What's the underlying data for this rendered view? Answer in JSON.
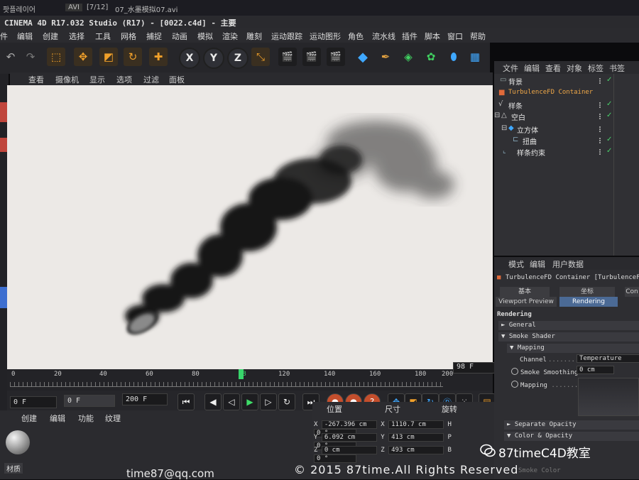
{
  "os_bar": {
    "left_label": "팟플레이어",
    "format": "AVI",
    "playlist_pos": "[7/12]",
    "file_name": "07_水墨模拟07.avi"
  },
  "title_bar": {
    "text": "CINEMA 4D R17.032 Studio (R17) - [0022.c4d] - 主要"
  },
  "menu": [
    "件",
    "编辑",
    "创建",
    "选择",
    "工具",
    "网格",
    "捕捉",
    "动画",
    "模拟",
    "渲染",
    "雕刻",
    "运动跟踪",
    "运动图形",
    "角色",
    "流水线",
    "插件",
    "脚本",
    "窗口",
    "帮助"
  ],
  "toolbar": {
    "axis_x": "X",
    "axis_y": "Y",
    "axis_z": "Z",
    "icons": [
      "undo-icon",
      "select-icon",
      "move-icon",
      "scale-icon",
      "rotate-icon",
      "add-icon",
      "coordinate-icon",
      "render-view-icon",
      "render-icon",
      "render-settings-icon",
      "cube-icon",
      "pen-icon",
      "subdivision-icon",
      "cloner-icon",
      "deformer-icon",
      "floor-icon"
    ]
  },
  "viewport": {
    "menu": [
      "查看",
      "摄像机",
      "显示",
      "选项",
      "过滤",
      "面板"
    ],
    "colors": {
      "background": "#ece9e6",
      "smoke": "#141414"
    }
  },
  "timeline": {
    "ticks": [
      "0",
      "20",
      "40",
      "60",
      "80",
      "100",
      "120",
      "140",
      "160",
      "180",
      "200"
    ],
    "current_frame": 98,
    "current_label": "98",
    "frame_display": "98 F"
  },
  "playback": {
    "start": "0 F",
    "min": "0 F",
    "max": "200 F",
    "buttons": [
      "go-start-icon",
      "prev-key-icon",
      "play-back-icon",
      "play-icon",
      "next-key-icon",
      "record-icon",
      "go-end-icon"
    ]
  },
  "material_panel": {
    "menu": [
      "创建",
      "编辑",
      "功能",
      "纹理"
    ],
    "material_label": "材质"
  },
  "coords_panel": {
    "headers": [
      "位置",
      "尺寸",
      "旋转"
    ],
    "rows": [
      {
        "axis": "X",
        "pos": "-267.396 cm",
        "size_axis": "X",
        "size": "1110.7 cm",
        "rot_axis": "H",
        "rot": "0 °"
      },
      {
        "axis": "Y",
        "pos": "6.092 cm",
        "size_axis": "Y",
        "size": "413 cm",
        "rot_axis": "P",
        "rot": "0 °"
      },
      {
        "axis": "Z",
        "pos": "0 cm",
        "size_axis": "Z",
        "size": "493 cm",
        "rot_axis": "B",
        "rot": "0 °"
      }
    ]
  },
  "object_manager": {
    "menu": [
      "文件",
      "编辑",
      "查看",
      "对象",
      "标签",
      "书签"
    ],
    "objects": [
      {
        "name": "背景",
        "icon": "background-icon"
      },
      {
        "name": "TurbulenceFD Container",
        "icon": "turbulence-icon"
      },
      {
        "name": "样条",
        "icon": "spline-icon"
      },
      {
        "name": "空白",
        "icon": "null-icon"
      },
      {
        "name": "立方体",
        "icon": "cube-icon"
      },
      {
        "name": "扭曲",
        "icon": "twist-icon"
      },
      {
        "name": "样条约束",
        "icon": "spline-wrap-icon"
      }
    ]
  },
  "attribute_manager": {
    "menu": [
      "模式",
      "编辑",
      "用户数据"
    ],
    "object_title": "TurbulenceFD Container [TurbulenceFD C",
    "tabs_row1": [
      "基本",
      "坐标",
      "Con"
    ],
    "tabs_row2": [
      "Viewport Preview",
      "Rendering"
    ],
    "section": "Rendering",
    "groups": [
      "General",
      "Smoke Shader",
      "Mapping"
    ],
    "channel_label": "Channel",
    "channel_value": "Temperature",
    "smoothing_label": "Smoke Smoothing",
    "smoothing_value": "0 cm",
    "mapping_label": "Mapping",
    "bottom_groups": [
      "Separate Opacity",
      "Color & Opacity"
    ],
    "bottom_fade": "Smoke Color"
  },
  "watermark": {
    "brand": "87timeC4D教室",
    "copyright": "© 2015 87time.All Rights Reserved",
    "email": "time87@qq.com"
  }
}
